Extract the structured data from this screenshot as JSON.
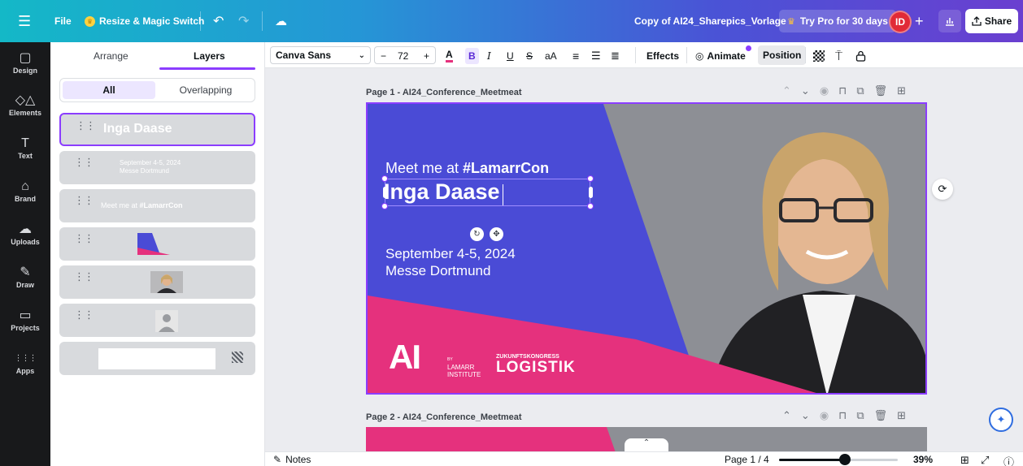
{
  "topbar": {
    "file_label": "File",
    "resize_label": "Resize & Magic Switch",
    "doc_title": "Copy of AI24_Sharepics_Vorlage",
    "try_pro_label": "Try Pro for 30 days",
    "avatar_initials": "ID",
    "share_label": "Share"
  },
  "rail": [
    {
      "label": "Design",
      "icon": "▢"
    },
    {
      "label": "Elements",
      "icon": "◇△"
    },
    {
      "label": "Text",
      "icon": "T"
    },
    {
      "label": "Brand",
      "icon": "⌂"
    },
    {
      "label": "Uploads",
      "icon": "☁"
    },
    {
      "label": "Draw",
      "icon": "✎"
    },
    {
      "label": "Projects",
      "icon": "▭"
    },
    {
      "label": "Apps",
      "icon": "⋮⋮⋮"
    }
  ],
  "panel": {
    "tab_arrange": "Arrange",
    "tab_layers": "Layers",
    "seg_all": "All",
    "seg_overlapping": "Overlapping",
    "layers": {
      "name": "Inga Daase",
      "date_line1": "September 4-5, 2024",
      "date_line2": "Messe Dortmund",
      "meet_prefix": "Meet me at ",
      "meet_tag": "#LamarrCon"
    }
  },
  "toolbar": {
    "font_name": "Canva Sans",
    "font_size": "72",
    "effects_label": "Effects",
    "animate_label": "Animate",
    "position_label": "Position"
  },
  "pages": {
    "page1_label": "Page 1 - AI24_Conference_Meetmeat",
    "page2_label": "Page 2 - AI24_Conference_Meetmeat"
  },
  "design": {
    "meet_prefix": "Meet me at ",
    "meet_tag": "#LamarrCon",
    "name": "Inga Daase",
    "date_line1": "September 4-5, 2024",
    "date_line2": "Messe Dortmund",
    "logo_ai": "AI",
    "logo_by": "BY",
    "logo_lamarr": "LAMARR",
    "logo_institute": "INSTITUTE",
    "zk_top": "ZUKUNFTSKONGRESS",
    "zk_main": "LOGISTIK"
  },
  "footer": {
    "notes_label": "Notes",
    "page_indicator": "Page 1 / 4",
    "zoom": "39%",
    "zoom_fraction": 0.39
  },
  "colors": {
    "accent": "#8b3dff",
    "design_blue": "#4a4bd6",
    "design_pink": "#e5317d"
  }
}
